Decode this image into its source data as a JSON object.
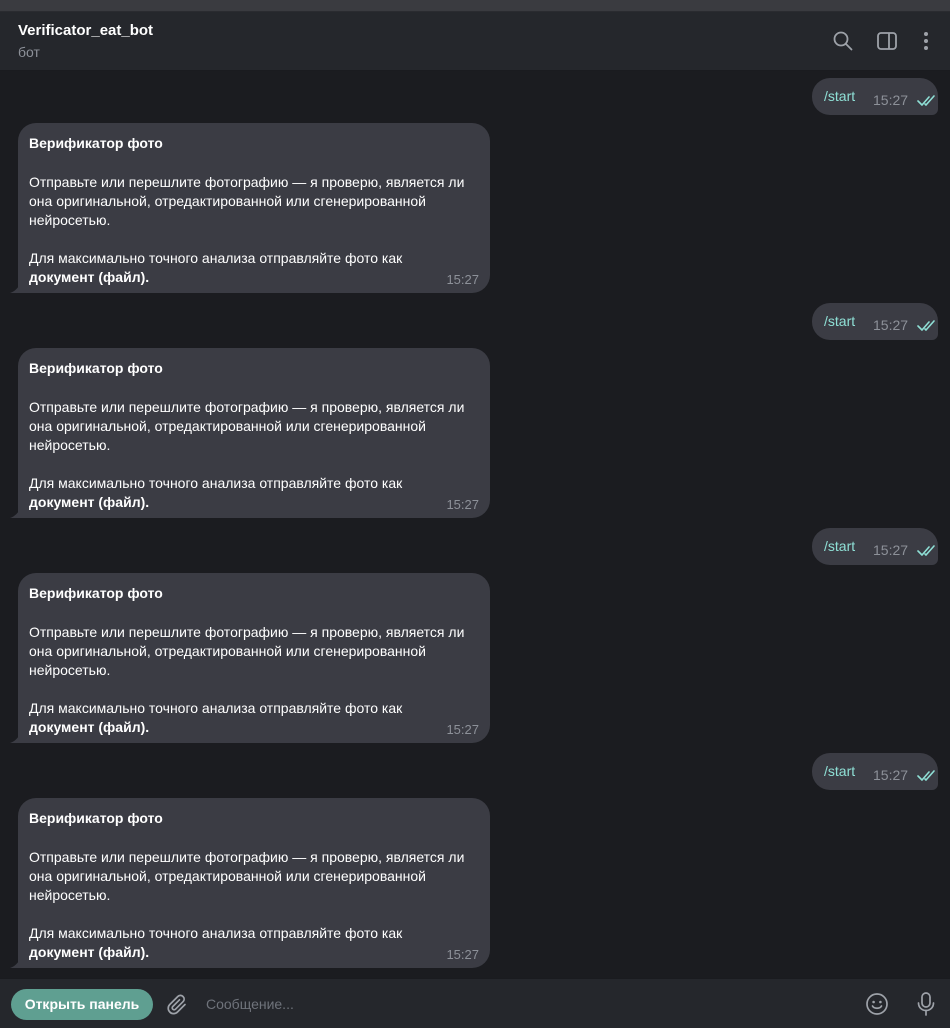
{
  "header": {
    "title": "Verificator_eat_bot",
    "subtitle": "бот",
    "icons": [
      "search-icon",
      "sidebar-panel-icon",
      "more-vertical-icon"
    ]
  },
  "colors": {
    "background": "#1b1c20",
    "header": "#25272c",
    "bubble": "#3b3c44",
    "command_text": "#8fe0d6",
    "accent_button": "#5f9f91",
    "read_check": "#8fe0d6",
    "muted": "#8d9199"
  },
  "messages": [
    {
      "direction": "out",
      "text": "/start",
      "time": "15:27",
      "status": "read"
    },
    {
      "direction": "in",
      "title": "Верификатор фото",
      "p1": "Отправьте или перешлите фотографию — я проверю, является ли она оригинальной, отредактированной или сгенерированной нейросетью.",
      "p2": "Для максимально точного анализа отправляйте фото как",
      "p2_bold": "документ (файл).",
      "time": "15:27"
    },
    {
      "direction": "out",
      "text": "/start",
      "time": "15:27",
      "status": "read"
    },
    {
      "direction": "in",
      "title": "Верификатор фото",
      "p1": "Отправьте или перешлите фотографию — я проверю, является ли она оригинальной, отредактированной или сгенерированной нейросетью.",
      "p2": "Для максимально точного анализа отправляйте фото как",
      "p2_bold": "документ (файл).",
      "time": "15:27"
    },
    {
      "direction": "out",
      "text": "/start",
      "time": "15:27",
      "status": "read"
    },
    {
      "direction": "in",
      "title": "Верификатор фото",
      "p1": "Отправьте или перешлите фотографию — я проверю, является ли она оригинальной, отредактированной или сгенерированной нейросетью.",
      "p2": "Для максимально точного анализа отправляйте фото как",
      "p2_bold": "документ (файл).",
      "time": "15:27"
    },
    {
      "direction": "out",
      "text": "/start",
      "time": "15:27",
      "status": "read"
    },
    {
      "direction": "in",
      "title": "Верификатор фото",
      "p1": "Отправьте или перешлите фотографию — я проверю, является ли она оригинальной, отредактированной или сгенерированной нейросетью.",
      "p2": "Для максимально точного анализа отправляйте фото как",
      "p2_bold": "документ (файл).",
      "time": "15:27"
    }
  ],
  "composer": {
    "panel_button": "Открыть панель",
    "placeholder": "Сообщение...",
    "icons": [
      "paperclip-icon",
      "emoji-icon",
      "microphone-icon"
    ]
  }
}
